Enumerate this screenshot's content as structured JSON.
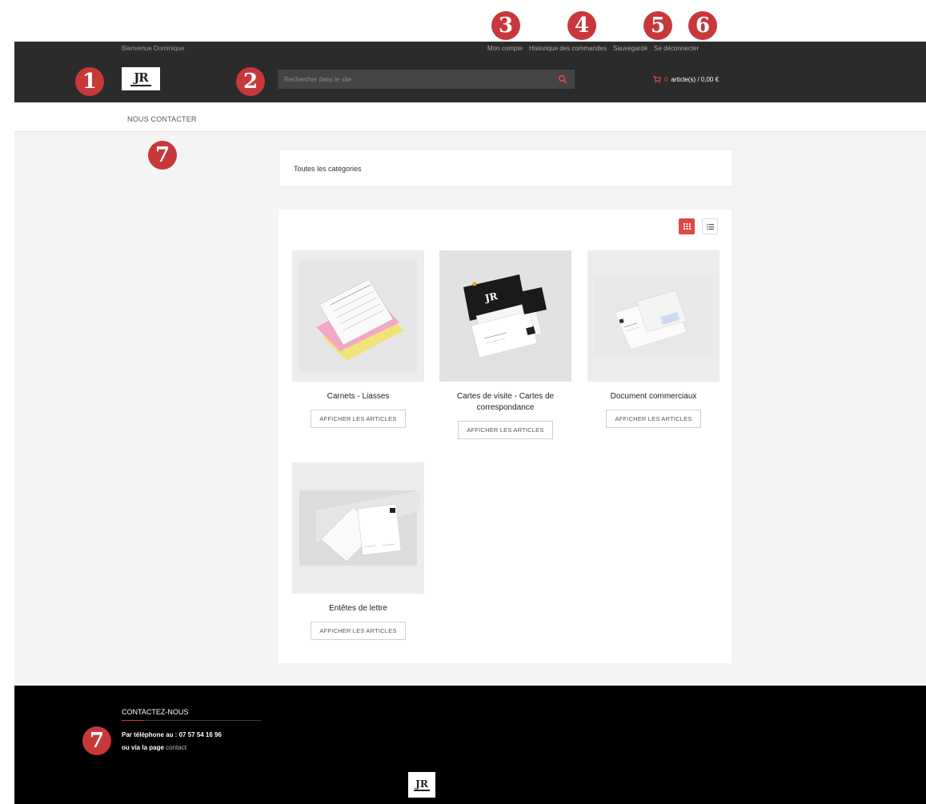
{
  "badges": [
    "1",
    "2",
    "3",
    "4",
    "5",
    "6",
    "7",
    "7"
  ],
  "header": {
    "welcome": "Bienvenue Dominique",
    "links": [
      "Mon compte",
      "Historique des commandes",
      "Sauvegardé",
      "Se déconnecter"
    ],
    "logo_text": "JR",
    "search_placeholder": "Rechercher dans le site",
    "cart_count": "0",
    "cart_summary": "article(s) / 0,00 €"
  },
  "nav": {
    "contact": "NOUS CONTACTER"
  },
  "main": {
    "category_breadcrumb": "Toutes les catégories",
    "view_modes": [
      "grid-icon",
      "list-icon"
    ],
    "products": [
      {
        "title": "Carnets - Liasses",
        "button": "AFFICHER LES ARTICLES"
      },
      {
        "title": "Cartes de visite - Cartes de correspondance",
        "button": "AFFICHER LES ARTICLES"
      },
      {
        "title": "Document commerciaux",
        "button": "AFFICHER LES ARTICLES"
      },
      {
        "title": "Entêtes de lettre",
        "button": "AFFICHER LES ARTICLES"
      }
    ]
  },
  "footer": {
    "title": "CONTACTEZ-NOUS",
    "phone": "Par téléphone au : 07 57 54 16 96",
    "page_prefix": "ou via la page",
    "page_link": "contact",
    "logo_text": "JR"
  },
  "colors": {
    "accent": "#e04848",
    "badge": "#c8383b",
    "topbar": "#2b2b2b",
    "footer": "#000000"
  }
}
